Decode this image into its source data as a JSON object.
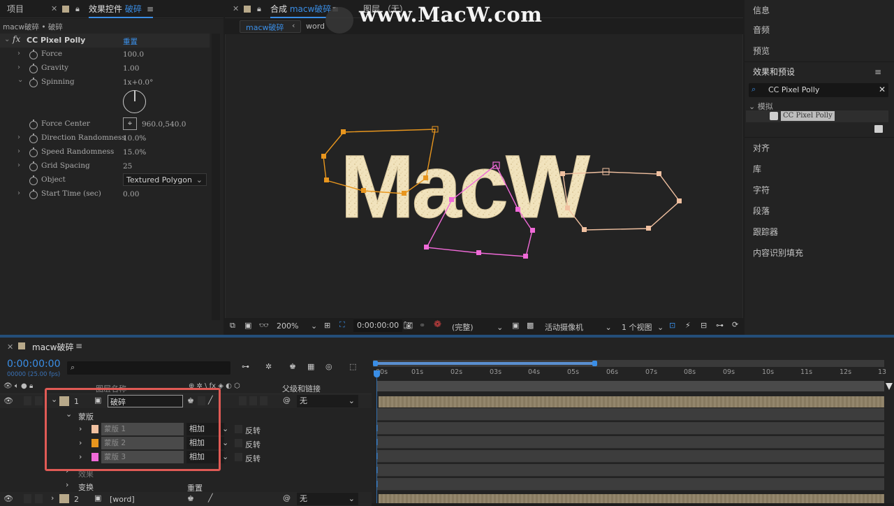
{
  "top_tabs": {
    "project": "项目",
    "effect_controls_prefix": "效果控件",
    "effect_controls_target": "破碎",
    "comp_prefix": "合成",
    "comp_name": "macw破碎",
    "layer_panel": "图层 （无）",
    "watermark": "www.MacW.com"
  },
  "comp_tabs": [
    "macw破碎",
    "word"
  ],
  "effect_controls": {
    "breadcrumb": "macw破碎 • 破碎",
    "effect_name": "CC Pixel Polly",
    "reset": "重置",
    "params": [
      {
        "name": "Force",
        "value": "100.0"
      },
      {
        "name": "Gravity",
        "value": "1.00"
      },
      {
        "name": "Spinning",
        "value": "1x+0.0°"
      },
      {
        "name": "Force Center",
        "value": "960.0,540.0"
      },
      {
        "name": "Direction Randomness",
        "value": "10.0%"
      },
      {
        "name": "Speed Randomness",
        "value": "15.0%"
      },
      {
        "name": "Grid Spacing",
        "value": "25"
      },
      {
        "name": "Object",
        "value": "Textured Polygon"
      },
      {
        "name": "Start Time (sec)",
        "value": "0.00"
      }
    ]
  },
  "viewer": {
    "text": "MacW",
    "zoom": "200%",
    "timecode": "0:00:00:00",
    "resolution": "(完整)",
    "camera": "活动摄像机",
    "views": "1 个视图",
    "mask_colors": [
      "#e8961e",
      "#f06ad8",
      "#f0c0a0"
    ]
  },
  "right_panel": {
    "items_top": [
      "信息",
      "音频",
      "预览"
    ],
    "effects_presets_title": "效果和预设",
    "search_value": "CC Pixel Polly",
    "category": "模拟",
    "result": "CC Pixel Polly",
    "items_bottom": [
      "对齐",
      "库",
      "字符",
      "段落",
      "跟踪器",
      "内容识别填充"
    ]
  },
  "timeline": {
    "comp_name": "macw破碎",
    "timecode": "0:00:00:00",
    "fps": "00000 (25.00 fps)",
    "search_placeholder": "",
    "col_source": "图层名称",
    "col_parent": "父级和链接",
    "ruler": [
      "00s",
      "01s",
      "02s",
      "03s",
      "04s",
      "05s",
      "06s",
      "07s",
      "08s",
      "09s",
      "10s",
      "11s",
      "12s",
      "13"
    ],
    "layers": [
      {
        "num": "1",
        "name": "破碎",
        "parent": "无",
        "color": "#b8a98a"
      },
      {
        "num": "2",
        "name": "[word]",
        "parent": "无",
        "color": "#b8a98a"
      }
    ],
    "masks_group": "蒙版",
    "masks": [
      {
        "name": "蒙版 1",
        "mode": "相加",
        "invert": "反转",
        "color": "#f0c0a0"
      },
      {
        "name": "蒙版 2",
        "mode": "相加",
        "invert": "反转",
        "color": "#e8961e"
      },
      {
        "name": "蒙版 3",
        "mode": "相加",
        "invert": "反转",
        "color": "#f06ad8"
      }
    ],
    "effects_group": "效果",
    "transform": "变换",
    "transform_reset": "重置"
  },
  "accent_color": "#3a8ee6",
  "highlight_color": "#e05a55"
}
